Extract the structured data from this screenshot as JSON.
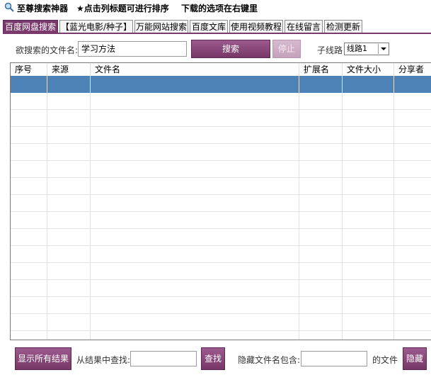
{
  "titlebar": {
    "app_title": "至尊搜索神器",
    "hint_sort": "★点击列标题可进行排序",
    "hint_download": "下载的选项在右键里"
  },
  "tabs": [
    {
      "label": "百度网盘搜索",
      "active": true
    },
    {
      "label": "【蓝光电影/种子】",
      "active": false
    },
    {
      "label": "万能网站搜索",
      "active": false
    },
    {
      "label": "百度文库",
      "active": false
    },
    {
      "label": "使用视频教程",
      "active": false
    },
    {
      "label": "在线留言",
      "active": false
    },
    {
      "label": "检测更新",
      "active": false
    }
  ],
  "search": {
    "label": "欲搜索的文件名:",
    "value": "学习方法",
    "search_button": "搜索",
    "stop_button": "停止",
    "line_label": "子线路",
    "line_selected": "线路1"
  },
  "table": {
    "columns": [
      "序号",
      "来源",
      "文件名",
      "扩展名",
      "文件大小",
      "分享者"
    ],
    "selected_row": 0,
    "empty_rows": 15
  },
  "footer": {
    "show_all_button": "显示所有结果",
    "find_label": "从结果中查找:",
    "find_value": "",
    "find_button": "查找",
    "hide_label": "隐藏文件名包含:",
    "hide_value": "",
    "hide_suffix": "的文件",
    "hide_button": "隐藏"
  },
  "colors": {
    "accent": "#7a3a6c",
    "selection": "#4c82b5"
  }
}
